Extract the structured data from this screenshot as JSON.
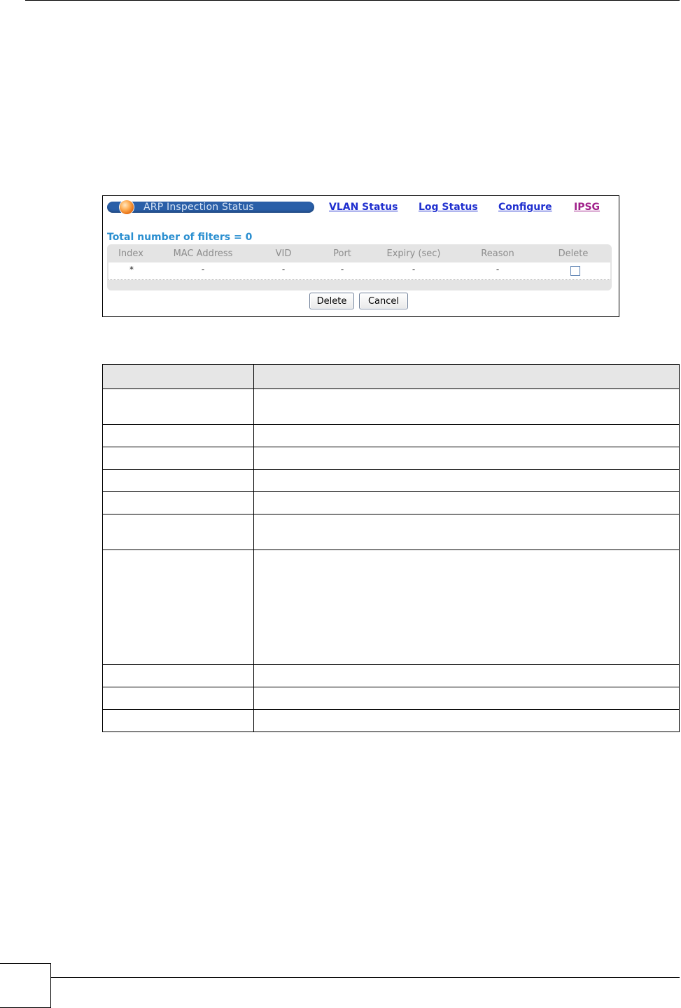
{
  "window": {
    "title": "ARP Inspection Status"
  },
  "nav": {
    "links": [
      {
        "label": "VLAN Status"
      },
      {
        "label": "Log Status"
      },
      {
        "label": "Configure"
      },
      {
        "label": "IPSG"
      }
    ]
  },
  "summary": {
    "total_filters": "Total number of filters = 0"
  },
  "grid": {
    "columns": [
      "Index",
      "MAC Address",
      "VID",
      "Port",
      "Expiry (sec)",
      "Reason",
      "Delete"
    ],
    "rows": [
      {
        "index": "*",
        "mac": "-",
        "vid": "-",
        "port": "-",
        "expiry": "-",
        "reason": "-",
        "delete_checked": false
      }
    ]
  },
  "buttons": {
    "delete": "Delete",
    "cancel": "Cancel"
  },
  "colors": {
    "title_bar": "#2a5fa8",
    "link": "#1f2fcf",
    "link_visited": "#a0208a",
    "summary_text": "#2b8fd0"
  }
}
